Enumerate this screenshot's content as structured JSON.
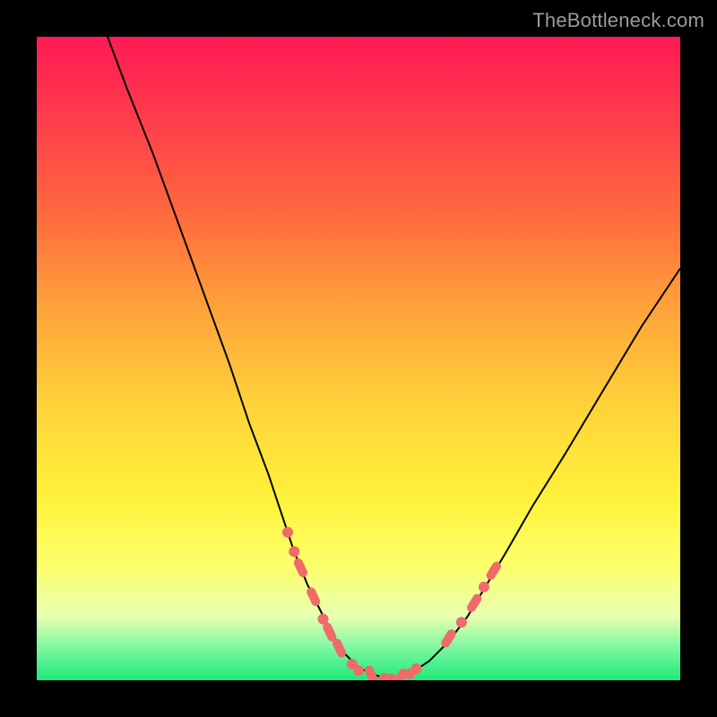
{
  "watermark": "TheBottleneck.com",
  "colors": {
    "page_bg": "#000000",
    "curve": "#000000",
    "marker": "#f06a6a",
    "gradient_top": "#ff1a54",
    "gradient_bottom": "#1ee97a"
  },
  "chart_data": {
    "type": "line",
    "title": "",
    "xlabel": "",
    "ylabel": "",
    "xlim": [
      0,
      100
    ],
    "ylim": [
      0,
      100
    ],
    "legend": false,
    "grid": false,
    "left_curve": {
      "x": [
        11,
        14,
        18,
        22,
        26,
        30,
        33,
        36,
        38,
        40,
        42,
        44,
        46,
        48,
        50,
        52,
        55
      ],
      "y": [
        100,
        92,
        82,
        71,
        60,
        49,
        40,
        32,
        26,
        20,
        15,
        11,
        7,
        4,
        2,
        1,
        0
      ]
    },
    "right_curve": {
      "x": [
        55,
        58,
        61,
        64,
        67,
        70,
        73,
        77,
        82,
        88,
        94,
        100
      ],
      "y": [
        0,
        1,
        3,
        6,
        10,
        15,
        20,
        27,
        35,
        45,
        55,
        64
      ]
    },
    "markers": [
      {
        "x": 39,
        "y": 23,
        "kind": "dot"
      },
      {
        "x": 40,
        "y": 20,
        "kind": "dot"
      },
      {
        "x": 41,
        "y": 17.5,
        "kind": "pill"
      },
      {
        "x": 43,
        "y": 13,
        "kind": "pill"
      },
      {
        "x": 44.5,
        "y": 9.5,
        "kind": "dot"
      },
      {
        "x": 45.5,
        "y": 7.5,
        "kind": "pill"
      },
      {
        "x": 47,
        "y": 5,
        "kind": "pill"
      },
      {
        "x": 49,
        "y": 2.5,
        "kind": "dot"
      },
      {
        "x": 50,
        "y": 1.5,
        "kind": "dot"
      },
      {
        "x": 52,
        "y": 0.8,
        "kind": "pill"
      },
      {
        "x": 54,
        "y": 0.3,
        "kind": "dot"
      },
      {
        "x": 55,
        "y": 0.2,
        "kind": "dot"
      },
      {
        "x": 56.5,
        "y": 0.4,
        "kind": "pill"
      },
      {
        "x": 58,
        "y": 1,
        "kind": "dot"
      },
      {
        "x": 59,
        "y": 1.8,
        "kind": "dot"
      },
      {
        "x": 64,
        "y": 6.5,
        "kind": "pill"
      },
      {
        "x": 66,
        "y": 9,
        "kind": "dot"
      },
      {
        "x": 68,
        "y": 12,
        "kind": "pill"
      },
      {
        "x": 69.5,
        "y": 14.5,
        "kind": "dot"
      },
      {
        "x": 71,
        "y": 17,
        "kind": "pill"
      }
    ]
  }
}
